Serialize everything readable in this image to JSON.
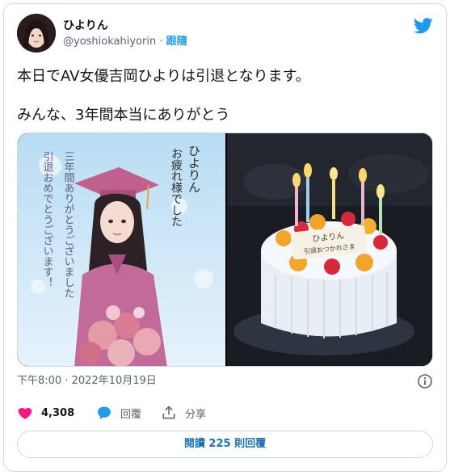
{
  "author": {
    "display_name": "ひよりん",
    "handle": "@yoshiokahiyorin",
    "separator": " · ",
    "follow_label": "跟隨"
  },
  "tweet": {
    "line1": "本日でAV女優吉岡ひよりは引退となります。",
    "line2": "みんな、3年間本当にありがとう"
  },
  "media": {
    "left_card": {
      "col1": "ひよりん",
      "col2": "お疲れ様でした",
      "col3": "三年間ありがとうございました",
      "col4": "引退おめでとうございます！"
    },
    "right_cake": {
      "plaque_line1": "ひよりん",
      "plaque_line2": "引退おつかれさま"
    }
  },
  "meta": {
    "timestamp": "下午8:00 · 2022年10月19日"
  },
  "actions": {
    "likes": "4,308",
    "reply_label": "回覆",
    "share_label": "分享"
  },
  "read_replies": {
    "prefix": "閱讀 ",
    "count": "225",
    "suffix": " 則回覆"
  },
  "colors": {
    "accent": "#1d9bf0",
    "like": "#f91880",
    "text": "#0f1419",
    "muted": "#536471",
    "border": "#cfd9de"
  },
  "icons": [
    "twitter-bird-icon",
    "info-icon",
    "heart-icon",
    "reply-bubble-icon",
    "share-icon"
  ]
}
